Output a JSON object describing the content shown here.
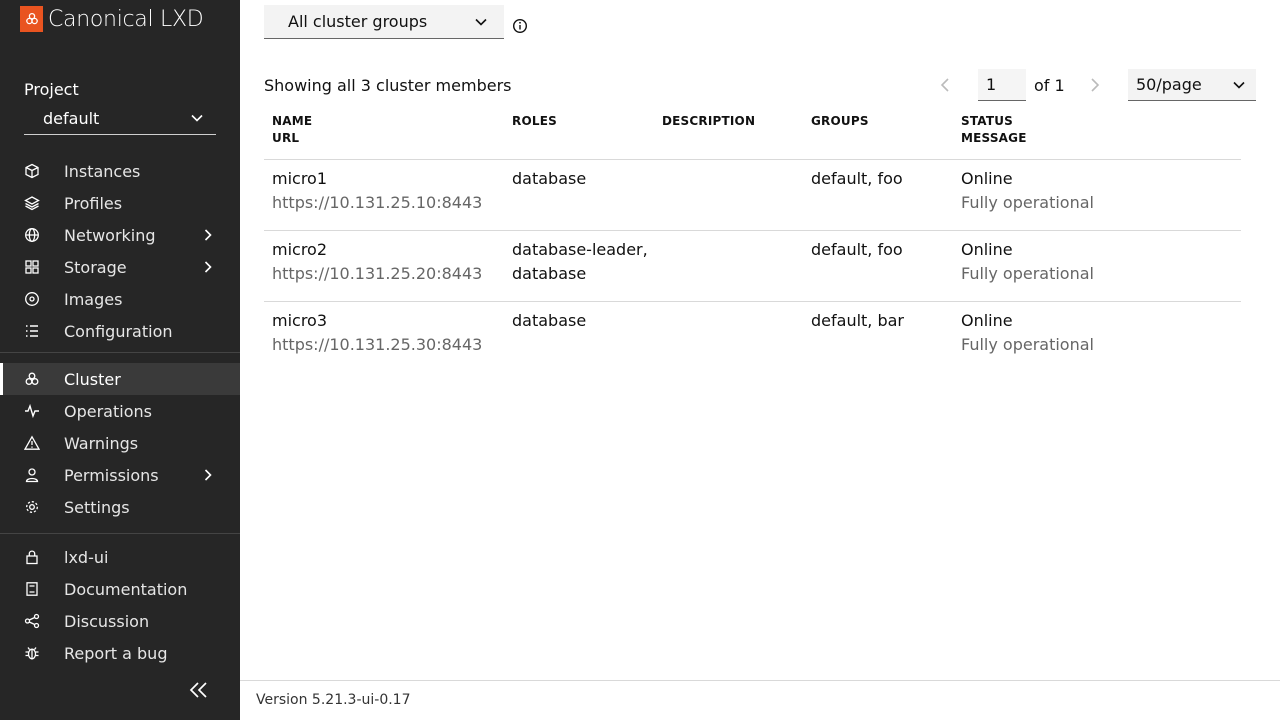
{
  "app": {
    "brand": "Canonical LXD",
    "version": "Version 5.21.3-ui-0.17"
  },
  "sidebar": {
    "project_label": "Project",
    "project_value": "default",
    "nav": [
      {
        "label": "Instances",
        "icon": "cube-icon"
      },
      {
        "label": "Profiles",
        "icon": "layers-icon"
      },
      {
        "label": "Networking",
        "icon": "globe-icon",
        "has_submenu": true
      },
      {
        "label": "Storage",
        "icon": "grid-icon",
        "has_submenu": true
      },
      {
        "label": "Images",
        "icon": "image-disc-icon"
      },
      {
        "label": "Configuration",
        "icon": "list-icon"
      },
      {
        "label": "Cluster",
        "icon": "cluster-icon",
        "active": true
      },
      {
        "label": "Operations",
        "icon": "pulse-icon"
      },
      {
        "label": "Warnings",
        "icon": "warning-icon"
      },
      {
        "label": "Permissions",
        "icon": "user-icon",
        "has_submenu": true
      },
      {
        "label": "Settings",
        "icon": "gear-icon"
      }
    ],
    "links": [
      {
        "label": "lxd-ui",
        "icon": "lock-icon"
      },
      {
        "label": "Documentation",
        "icon": "book-icon"
      },
      {
        "label": "Discussion",
        "icon": "share-icon"
      },
      {
        "label": "Report a bug",
        "icon": "bug-icon"
      }
    ]
  },
  "filter": {
    "group_select": "All cluster groups"
  },
  "summary": "Showing all 3 cluster members",
  "pagination": {
    "page": "1",
    "of_label": "of 1",
    "per_page": "50/page"
  },
  "table": {
    "headers": {
      "name": "NAME",
      "url": "URL",
      "roles": "ROLES",
      "description": "DESCRIPTION",
      "groups": "GROUPS",
      "status": "STATUS",
      "message": "MESSAGE"
    },
    "rows": [
      {
        "name": "micro1",
        "url": "https://10.131.25.10:8443",
        "roles_1": "database",
        "roles_2": "",
        "description": "",
        "groups": "default, foo",
        "status": "Online",
        "message": "Fully operational"
      },
      {
        "name": "micro2",
        "url": "https://10.131.25.20:8443",
        "roles_1": "database-leader,",
        "roles_2": "database",
        "description": "",
        "groups": "default, foo",
        "status": "Online",
        "message": "Fully operational"
      },
      {
        "name": "micro3",
        "url": "https://10.131.25.30:8443",
        "roles_1": "database",
        "roles_2": "",
        "description": "",
        "groups": "default, bar",
        "status": "Online",
        "message": "Fully operational"
      }
    ]
  },
  "colors": {
    "brand": "#e95420",
    "sidebar_bg": "#262626",
    "active_bg": "#3a3a3a"
  }
}
